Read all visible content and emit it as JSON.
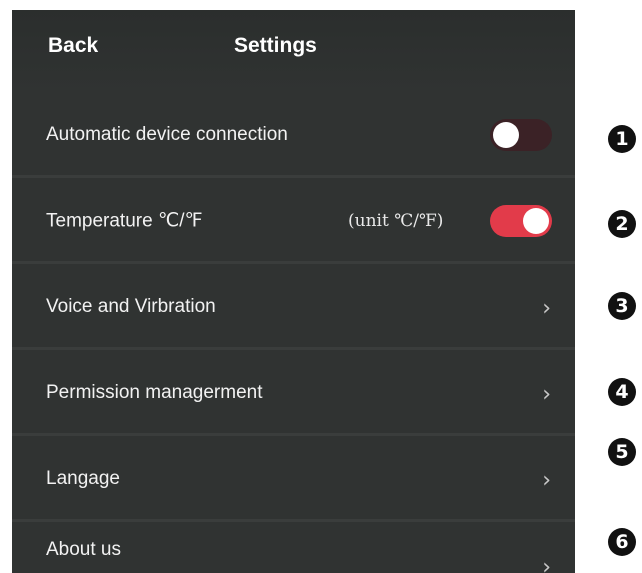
{
  "header": {
    "back_label": "Back",
    "title": "Settings"
  },
  "rows": [
    {
      "label": "Automatic device connection",
      "control": "toggle",
      "toggle_state": "off"
    },
    {
      "label": "Temperature ℃/℉",
      "control": "toggle",
      "unit_text": "(unit ℃/℉)",
      "toggle_state": "on"
    },
    {
      "label": "Voice and Virbration",
      "control": "chevron",
      "icon": "chevron-right-icon"
    },
    {
      "label": "Permission managerment",
      "control": "chevron",
      "icon": "chevron-right-icon"
    },
    {
      "label": "Langage",
      "control": "chevron",
      "icon": "chevron-right-icon"
    },
    {
      "label": "About us",
      "control": "chevron",
      "icon": "chevron-right-icon"
    }
  ],
  "markers": [
    "1",
    "2",
    "3",
    "4",
    "5",
    "6"
  ],
  "colors": {
    "background": "#303332",
    "toggle_on": "#e23b4a",
    "toggle_off": "#3b2226",
    "text": "#f2f2f2",
    "marker": "#111111"
  }
}
